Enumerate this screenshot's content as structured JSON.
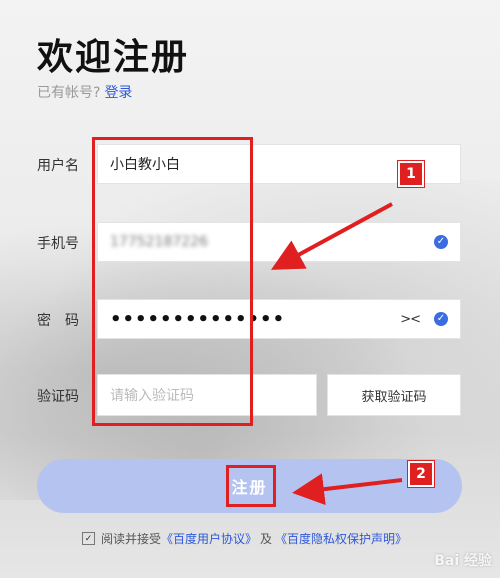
{
  "header": {
    "title": "欢迎注册",
    "have_account_text": "已有帐号?",
    "login_link": "登录"
  },
  "form": {
    "username": {
      "label": "用户名",
      "value": "小白教小白"
    },
    "phone": {
      "label": "手机号",
      "value": "17752187226"
    },
    "password": {
      "label": "密　码",
      "value": "••••••••••••••"
    },
    "verify": {
      "label": "验证码",
      "placeholder": "请输入验证码",
      "button": "获取验证码"
    },
    "submit": "注册"
  },
  "agreement": {
    "checkbox": "✓",
    "prefix": "阅读并接受",
    "link1": "《百度用户协议》",
    "middle": "及",
    "link2": "《百度隐私权保护声明》"
  },
  "annotations": {
    "badge1": "1",
    "badge2": "2"
  },
  "watermark": "Bai 经验",
  "colors": {
    "accent": "#2e58d8",
    "button": "#b5c3f0",
    "annotation": "#e02020"
  }
}
